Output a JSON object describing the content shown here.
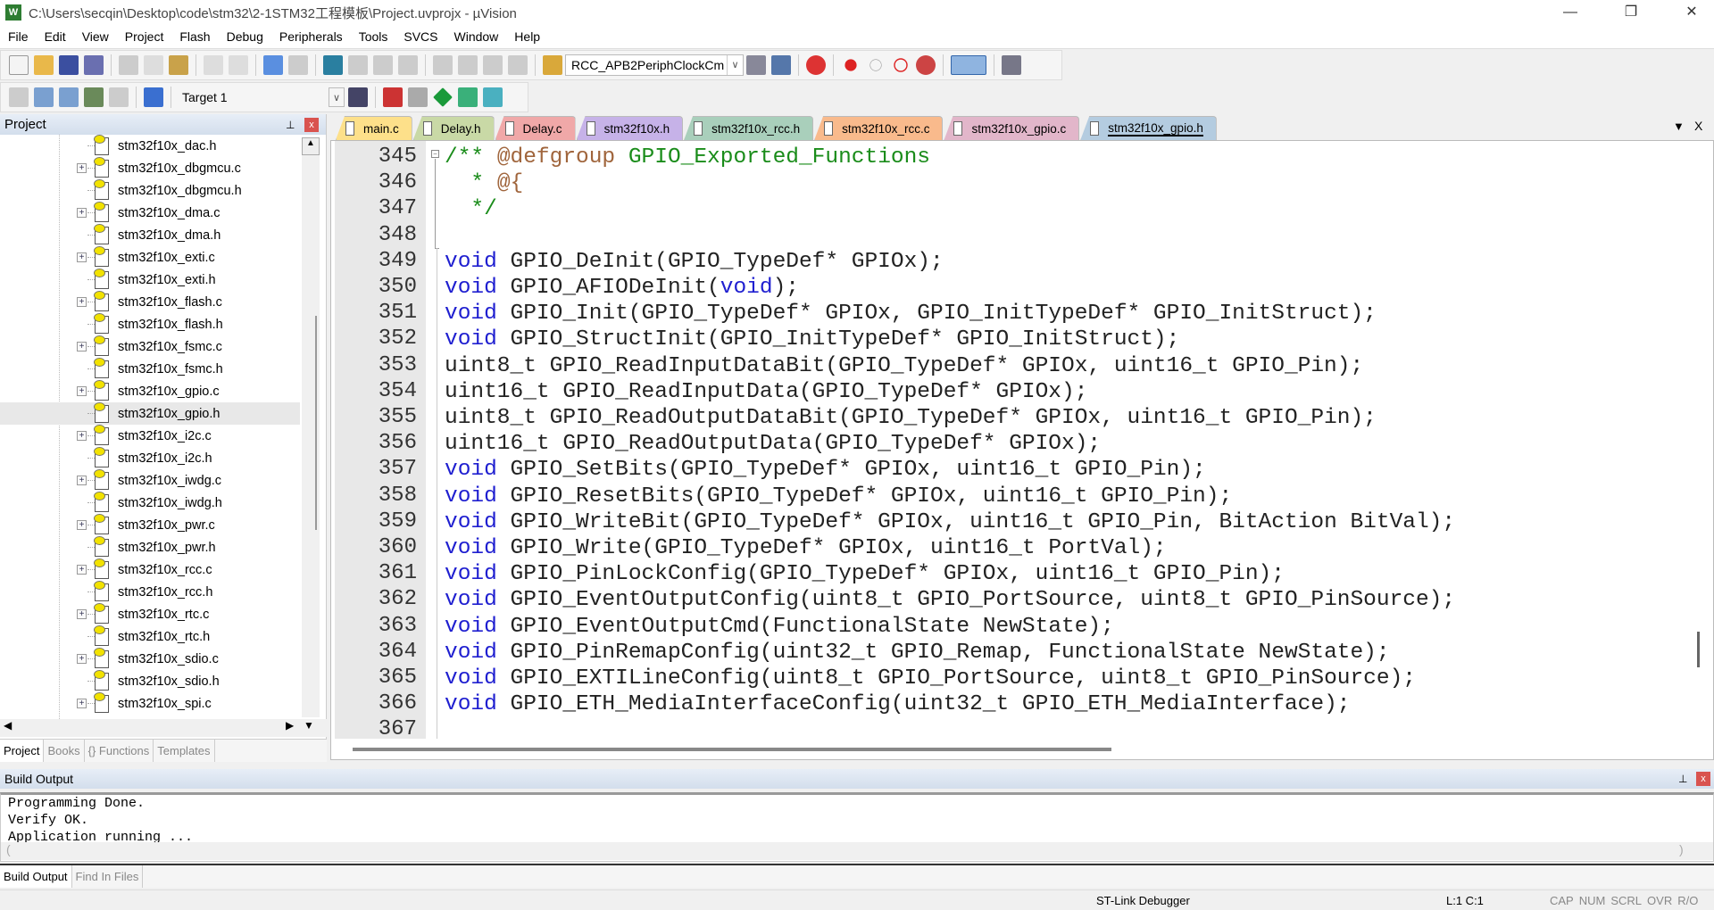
{
  "window": {
    "title": "C:\\Users\\secqin\\Desktop\\code\\stm32\\2-1STM32工程模板\\Project.uvprojx - µVision",
    "app_icon": "W",
    "minimize": "—",
    "maximize": "❐",
    "close": "✕"
  },
  "menu": [
    "File",
    "Edit",
    "View",
    "Project",
    "Flash",
    "Debug",
    "Peripherals",
    "Tools",
    "SVCS",
    "Window",
    "Help"
  ],
  "toolbar1": {
    "find_combo": "RCC_APB2PeriphClockCm"
  },
  "toolbar2": {
    "target_combo": "Target 1"
  },
  "project_panel": {
    "title": "Project",
    "pin": "⊥",
    "close": "x",
    "items": [
      {
        "label": "stm32f10x_dac.h",
        "expand": false
      },
      {
        "label": "stm32f10x_dbgmcu.c",
        "expand": true
      },
      {
        "label": "stm32f10x_dbgmcu.h",
        "expand": false
      },
      {
        "label": "stm32f10x_dma.c",
        "expand": true
      },
      {
        "label": "stm32f10x_dma.h",
        "expand": false
      },
      {
        "label": "stm32f10x_exti.c",
        "expand": true
      },
      {
        "label": "stm32f10x_exti.h",
        "expand": false
      },
      {
        "label": "stm32f10x_flash.c",
        "expand": true
      },
      {
        "label": "stm32f10x_flash.h",
        "expand": false
      },
      {
        "label": "stm32f10x_fsmc.c",
        "expand": true
      },
      {
        "label": "stm32f10x_fsmc.h",
        "expand": false
      },
      {
        "label": "stm32f10x_gpio.c",
        "expand": true
      },
      {
        "label": "stm32f10x_gpio.h",
        "expand": false,
        "selected": true
      },
      {
        "label": "stm32f10x_i2c.c",
        "expand": true
      },
      {
        "label": "stm32f10x_i2c.h",
        "expand": false
      },
      {
        "label": "stm32f10x_iwdg.c",
        "expand": true
      },
      {
        "label": "stm32f10x_iwdg.h",
        "expand": false
      },
      {
        "label": "stm32f10x_pwr.c",
        "expand": true
      },
      {
        "label": "stm32f10x_pwr.h",
        "expand": false
      },
      {
        "label": "stm32f10x_rcc.c",
        "expand": true
      },
      {
        "label": "stm32f10x_rcc.h",
        "expand": false
      },
      {
        "label": "stm32f10x_rtc.c",
        "expand": true
      },
      {
        "label": "stm32f10x_rtc.h",
        "expand": false
      },
      {
        "label": "stm32f10x_sdio.c",
        "expand": true
      },
      {
        "label": "stm32f10x_sdio.h",
        "expand": false
      },
      {
        "label": "stm32f10x_spi.c",
        "expand": true
      }
    ],
    "tabs": [
      {
        "label": "Project",
        "active": true
      },
      {
        "label": "Books"
      },
      {
        "label": "{} Functions"
      },
      {
        "label": "Templates"
      }
    ]
  },
  "editor_tabs": [
    {
      "label": "main.c",
      "color": "#fde08a"
    },
    {
      "label": "Delay.h",
      "color": "#c9d9a6"
    },
    {
      "label": "Delay.c",
      "color": "#f0a8a8"
    },
    {
      "label": "stm32f10x.h",
      "color": "#c6b2e8"
    },
    {
      "label": "stm32f10x_rcc.h",
      "color": "#a9cfbb"
    },
    {
      "label": "stm32f10x_rcc.c",
      "color": "#f9ba8c"
    },
    {
      "label": "stm32f10x_gpio.c",
      "color": "#e2b6ca"
    },
    {
      "label": "stm32f10x_gpio.h",
      "color": "#b4cce0",
      "active": true
    }
  ],
  "editor_tab_controls": {
    "menu": "▼",
    "close": "X"
  },
  "editor": {
    "lines": [
      {
        "n": "345",
        "s": [
          [
            "cm",
            "/** "
          ],
          [
            "tag",
            "@defgroup"
          ],
          [
            "cm",
            " GPIO_Exported_Functions"
          ]
        ]
      },
      {
        "n": "346",
        "s": [
          [
            "cm",
            "  * "
          ],
          [
            "tag",
            "@{"
          ]
        ]
      },
      {
        "n": "347",
        "s": [
          [
            "cm",
            "  */"
          ]
        ]
      },
      {
        "n": "348",
        "s": []
      },
      {
        "n": "349",
        "s": [
          [
            "kw",
            "void"
          ],
          [
            "",
            "GPIO_DeInit(GPIO_TypeDef* GPIOx);"
          ]
        ]
      },
      {
        "n": "350",
        "s": [
          [
            "kw",
            "void"
          ],
          [
            "",
            " GPIO_AFIODeInit("
          ],
          [
            "kw",
            "void"
          ],
          [
            "",
            ");"
          ]
        ]
      },
      {
        "n": "351",
        "s": [
          [
            "kw",
            "void"
          ],
          [
            "",
            " GPIO_Init(GPIO_TypeDef* GPIOx, GPIO_InitTypeDef* GPIO_InitStruct);"
          ]
        ]
      },
      {
        "n": "352",
        "s": [
          [
            "kw",
            "void"
          ],
          [
            "",
            " GPIO_StructInit(GPIO_InitTypeDef* GPIO_InitStruct);"
          ]
        ]
      },
      {
        "n": "353",
        "s": [
          [
            "",
            "uint8_t GPIO_ReadInputDataBit(GPIO_TypeDef* GPIOx, uint16_t GPIO_Pin);"
          ]
        ]
      },
      {
        "n": "354",
        "s": [
          [
            "",
            "uint16_t GPIO_ReadInputData(GPIO_TypeDef* GPIOx);"
          ]
        ]
      },
      {
        "n": "355",
        "s": [
          [
            "",
            "uint8_t GPIO_ReadOutputDataBit(GPIO_TypeDef* GPIOx, uint16_t GPIO_Pin);"
          ]
        ]
      },
      {
        "n": "356",
        "s": [
          [
            "",
            "uint16_t GPIO_ReadOutputData(GPIO_TypeDef* GPIOx);"
          ]
        ]
      },
      {
        "n": "357",
        "s": [
          [
            "kw",
            "void"
          ],
          [
            "",
            " GPIO_SetBits(GPIO_TypeDef* GPIOx, uint16_t GPIO_Pin);"
          ]
        ]
      },
      {
        "n": "358",
        "s": [
          [
            "kw",
            "void"
          ],
          [
            "",
            " GPIO_ResetBits(GPIO_TypeDef* GPIOx, uint16_t GPIO_Pin);"
          ]
        ]
      },
      {
        "n": "359",
        "s": [
          [
            "kw",
            "void"
          ],
          [
            "",
            " GPIO_WriteBit(GPIO_TypeDef* GPIOx, uint16_t GPIO_Pin, BitAction BitVal);"
          ]
        ]
      },
      {
        "n": "360",
        "s": [
          [
            "kw",
            "void"
          ],
          [
            "",
            " GPIO_Write(GPIO_TypeDef* GPIOx, uint16_t PortVal);"
          ]
        ]
      },
      {
        "n": "361",
        "s": [
          [
            "kw",
            "void"
          ],
          [
            "",
            " GPIO_PinLockConfig(GPIO_TypeDef* GPIOx, uint16_t GPIO_Pin);"
          ]
        ]
      },
      {
        "n": "362",
        "s": [
          [
            "kw",
            "void"
          ],
          [
            "",
            " GPIO_EventOutputConfig(uint8_t GPIO_PortSource, uint8_t GPIO_PinSource);"
          ]
        ]
      },
      {
        "n": "363",
        "s": [
          [
            "kw",
            "void"
          ],
          [
            "",
            " GPIO_EventOutputCmd(FunctionalState NewState);"
          ]
        ]
      },
      {
        "n": "364",
        "s": [
          [
            "kw",
            "void"
          ],
          [
            "",
            " GPIO_PinRemapConfig(uint32_t GPIO_Remap, FunctionalState NewState);"
          ]
        ]
      },
      {
        "n": "365",
        "s": [
          [
            "kw",
            "void"
          ],
          [
            "",
            " GPIO_EXTILineConfig(uint8_t GPIO_PortSource, uint8_t GPIO_PinSource);"
          ]
        ]
      },
      {
        "n": "366",
        "s": [
          [
            "kw",
            "void"
          ],
          [
            "",
            " GPIO_ETH_MediaInterfaceConfig(uint32_t GPIO_ETH_MediaInterface);"
          ]
        ]
      },
      {
        "n": "367",
        "s": []
      }
    ]
  },
  "build_output": {
    "title": "Build Output",
    "pin": "⊥",
    "close": "x",
    "lines": [
      "Programming Done.",
      "Verify OK.",
      "Application running ..."
    ],
    "tabs": [
      {
        "label": "Build Output",
        "active": true
      },
      {
        "label": "Find In Files"
      }
    ]
  },
  "status": {
    "debugger": "ST-Link Debugger",
    "position": "L:1 C:1",
    "indicators": [
      "CAP",
      "NUM",
      "SCRL",
      "OVR",
      "R/O"
    ]
  }
}
